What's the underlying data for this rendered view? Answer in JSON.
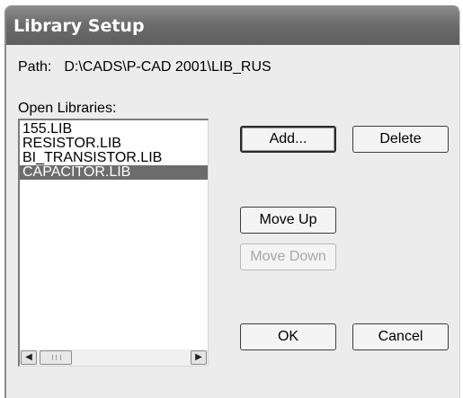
{
  "window": {
    "title": "Library Setup"
  },
  "path": {
    "label": "Path:",
    "value": "D:\\CADS\\P-CAD 2001\\LIB_RUS"
  },
  "open_libraries": {
    "label": "Open Libraries:",
    "items": [
      "155.LIB",
      "RESISTOR.LIB",
      "BI_TRANSISTOR.LIB",
      "CAPACITOR.LIB"
    ],
    "selected_index": 3
  },
  "buttons": {
    "add": "Add...",
    "delete": "Delete",
    "move_up": "Move Up",
    "move_down": "Move Down",
    "ok": "OK",
    "cancel": "Cancel"
  },
  "icons": {
    "scroll_left": "arrow-left-icon",
    "scroll_right": "arrow-right-icon"
  }
}
